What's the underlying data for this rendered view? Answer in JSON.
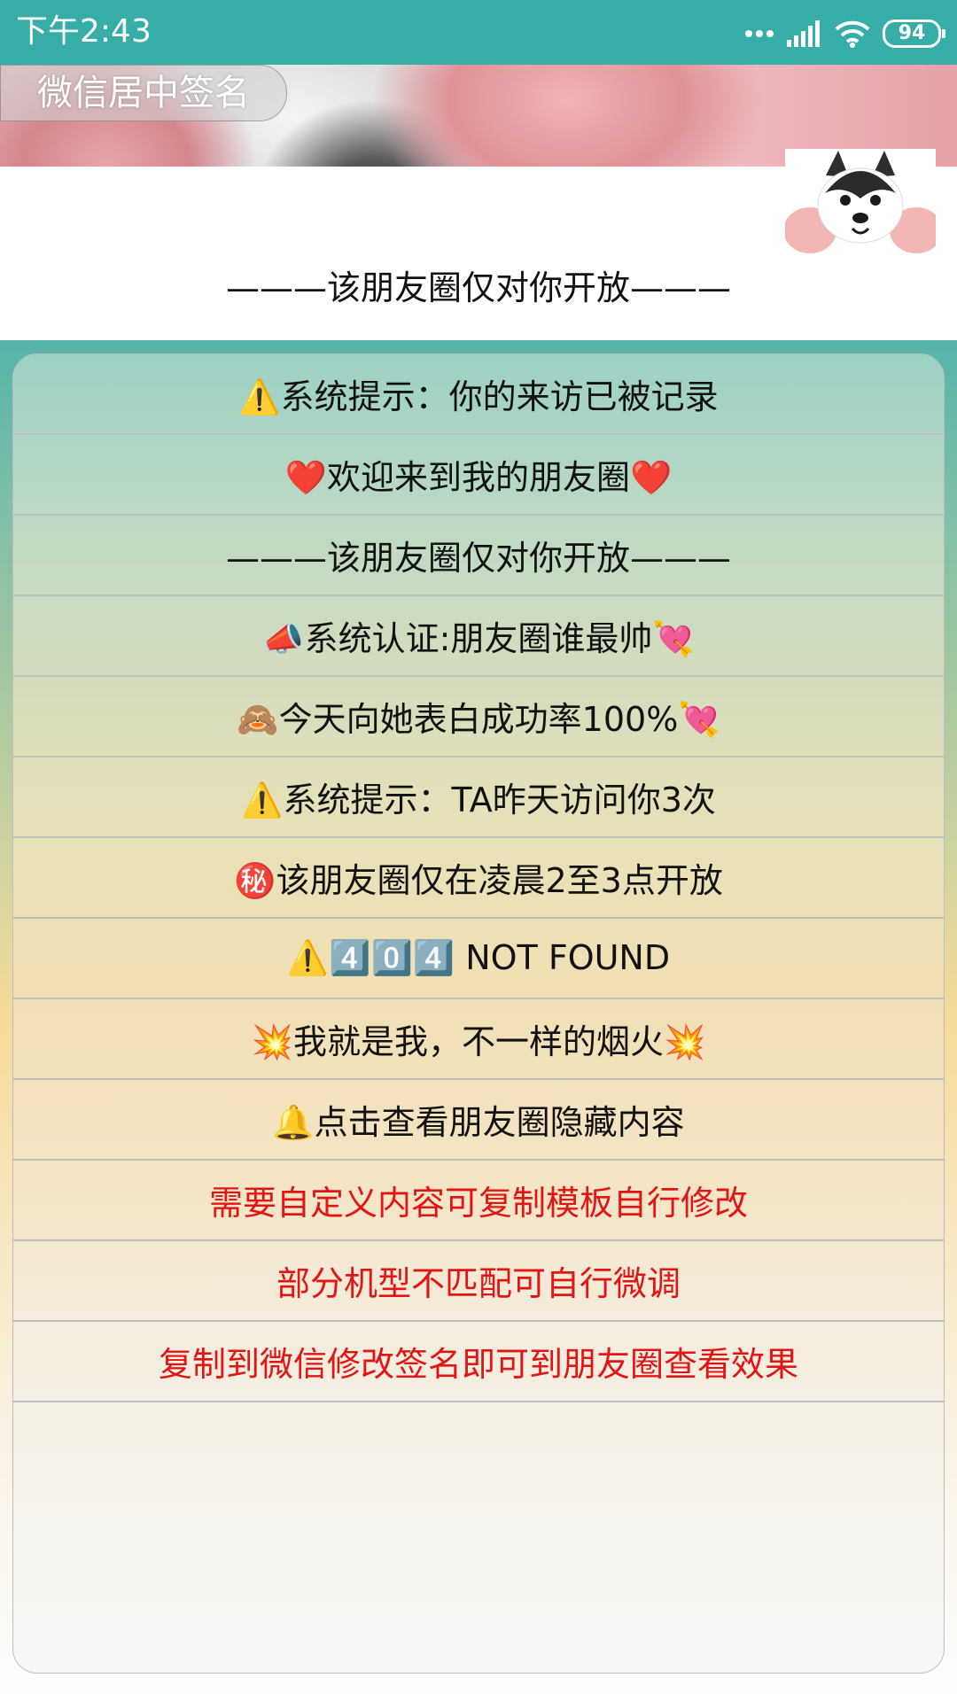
{
  "status_bar": {
    "time": "下午2:43",
    "battery": "94"
  },
  "cover": {
    "chip_label": "微信居中签名",
    "open_notice": "———该朋友圈仅对你开放———"
  },
  "list": [
    {
      "text": "⚠️系统提示：你的来访已被记录",
      "red": false
    },
    {
      "text": "❤️欢迎来到我的朋友圈❤️",
      "red": false
    },
    {
      "text": "———该朋友圈仅对你开放———",
      "red": false
    },
    {
      "text": "📣系统认证:朋友圈谁最帅💘",
      "red": false
    },
    {
      "text": "🙈今天向她表白成功率100%💘",
      "red": false
    },
    {
      "text": "⚠️系统提示：TA昨天访问你3次",
      "red": false
    },
    {
      "text": "㊙️该朋友圈仅在凌晨2至3点开放",
      "red": false
    },
    {
      "text": "⚠️4️⃣0️⃣4️⃣ NOT FOUND",
      "red": false
    },
    {
      "text": "💥我就是我，不一样的烟火💥",
      "red": false
    },
    {
      "text": "🔔点击查看朋友圈隐藏内容",
      "red": false
    },
    {
      "text": "需要自定义内容可复制模板自行修改",
      "red": true
    },
    {
      "text": "部分机型不匹配可自行微调",
      "red": true
    },
    {
      "text": "复制到微信修改签名即可到朋友圈查看效果",
      "red": true
    }
  ]
}
